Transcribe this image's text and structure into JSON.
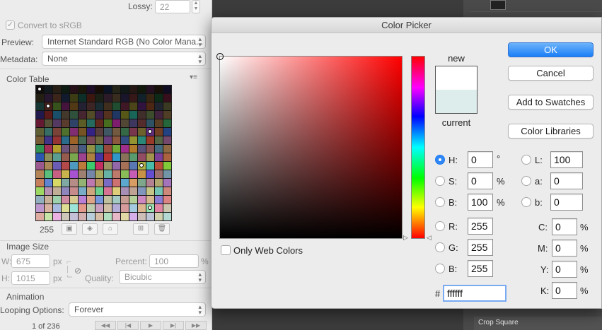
{
  "left_panel": {
    "lossy_label": "Lossy:",
    "lossy_value": "22",
    "convert_srgb_label": "Convert to sRGB",
    "convert_srgb_checked": "✓",
    "preview_label": "Preview:",
    "preview_value": "Internet Standard RGB (No Color Mana...",
    "metadata_label": "Metadata:",
    "metadata_value": "None",
    "color_table_label": "Color Table",
    "color_table_menu_icon": "menu-icon",
    "color_count": "255",
    "color_table_colors": [
      "#0d0d0e",
      "#1f1c1d",
      "#2d2427",
      "#3a2b33",
      "#2d2b3b",
      "#3a313a",
      "#3b3b44",
      "#2c3540",
      "#2f3b35",
      "#3d3a2f",
      "#433731",
      "#4a3530",
      "#3a2d2e",
      "#2d2428",
      "#1d1a1f",
      "#000000"
    ],
    "image_size_label": "Image Size",
    "width_label": "W:",
    "width_value": "675",
    "width_unit": "px",
    "height_label": "H:",
    "height_value": "1015",
    "height_unit": "px",
    "percent_label": "Percent:",
    "percent_value": "100",
    "percent_unit": "%",
    "quality_label": "Quality:",
    "quality_value": "Bicubic",
    "animation_label": "Animation",
    "looping_label": "Looping Options:",
    "looping_value": "Forever",
    "frame_counter": "1 of 236"
  },
  "background": {
    "top_layer_text": "... ... ...",
    "crop_square_label": "Crop Square"
  },
  "dialog": {
    "title": "Color Picker",
    "new_label": "new",
    "current_label": "current",
    "new_color": "#ffffff",
    "current_color": "#dcedeb",
    "ok_label": "OK",
    "cancel_label": "Cancel",
    "add_swatches_label": "Add to Swatches",
    "color_libraries_label": "Color Libraries",
    "only_web_colors_label": "Only Web Colors",
    "hsb": {
      "h_label": "H:",
      "h_value": "0",
      "h_unit": "°",
      "s_label": "S:",
      "s_value": "0",
      "s_unit": "%",
      "b_label": "B:",
      "b_value": "100",
      "b_unit": "%"
    },
    "rgb": {
      "r_label": "R:",
      "r_value": "255",
      "g_label": "G:",
      "g_value": "255",
      "b_label": "B:",
      "b_value": "255"
    },
    "lab": {
      "l_label": "L:",
      "l_value": "100",
      "a_label": "a:",
      "a_value": "0",
      "b_label": "b:",
      "b_value": "0"
    },
    "cmyk": {
      "c_label": "C:",
      "c_value": "0",
      "m_label": "M:",
      "m_value": "0",
      "y_label": "Y:",
      "y_value": "0",
      "k_label": "K:",
      "k_value": "0",
      "unit": "%"
    },
    "hex_label": "#",
    "hex_value": "ffffff"
  }
}
